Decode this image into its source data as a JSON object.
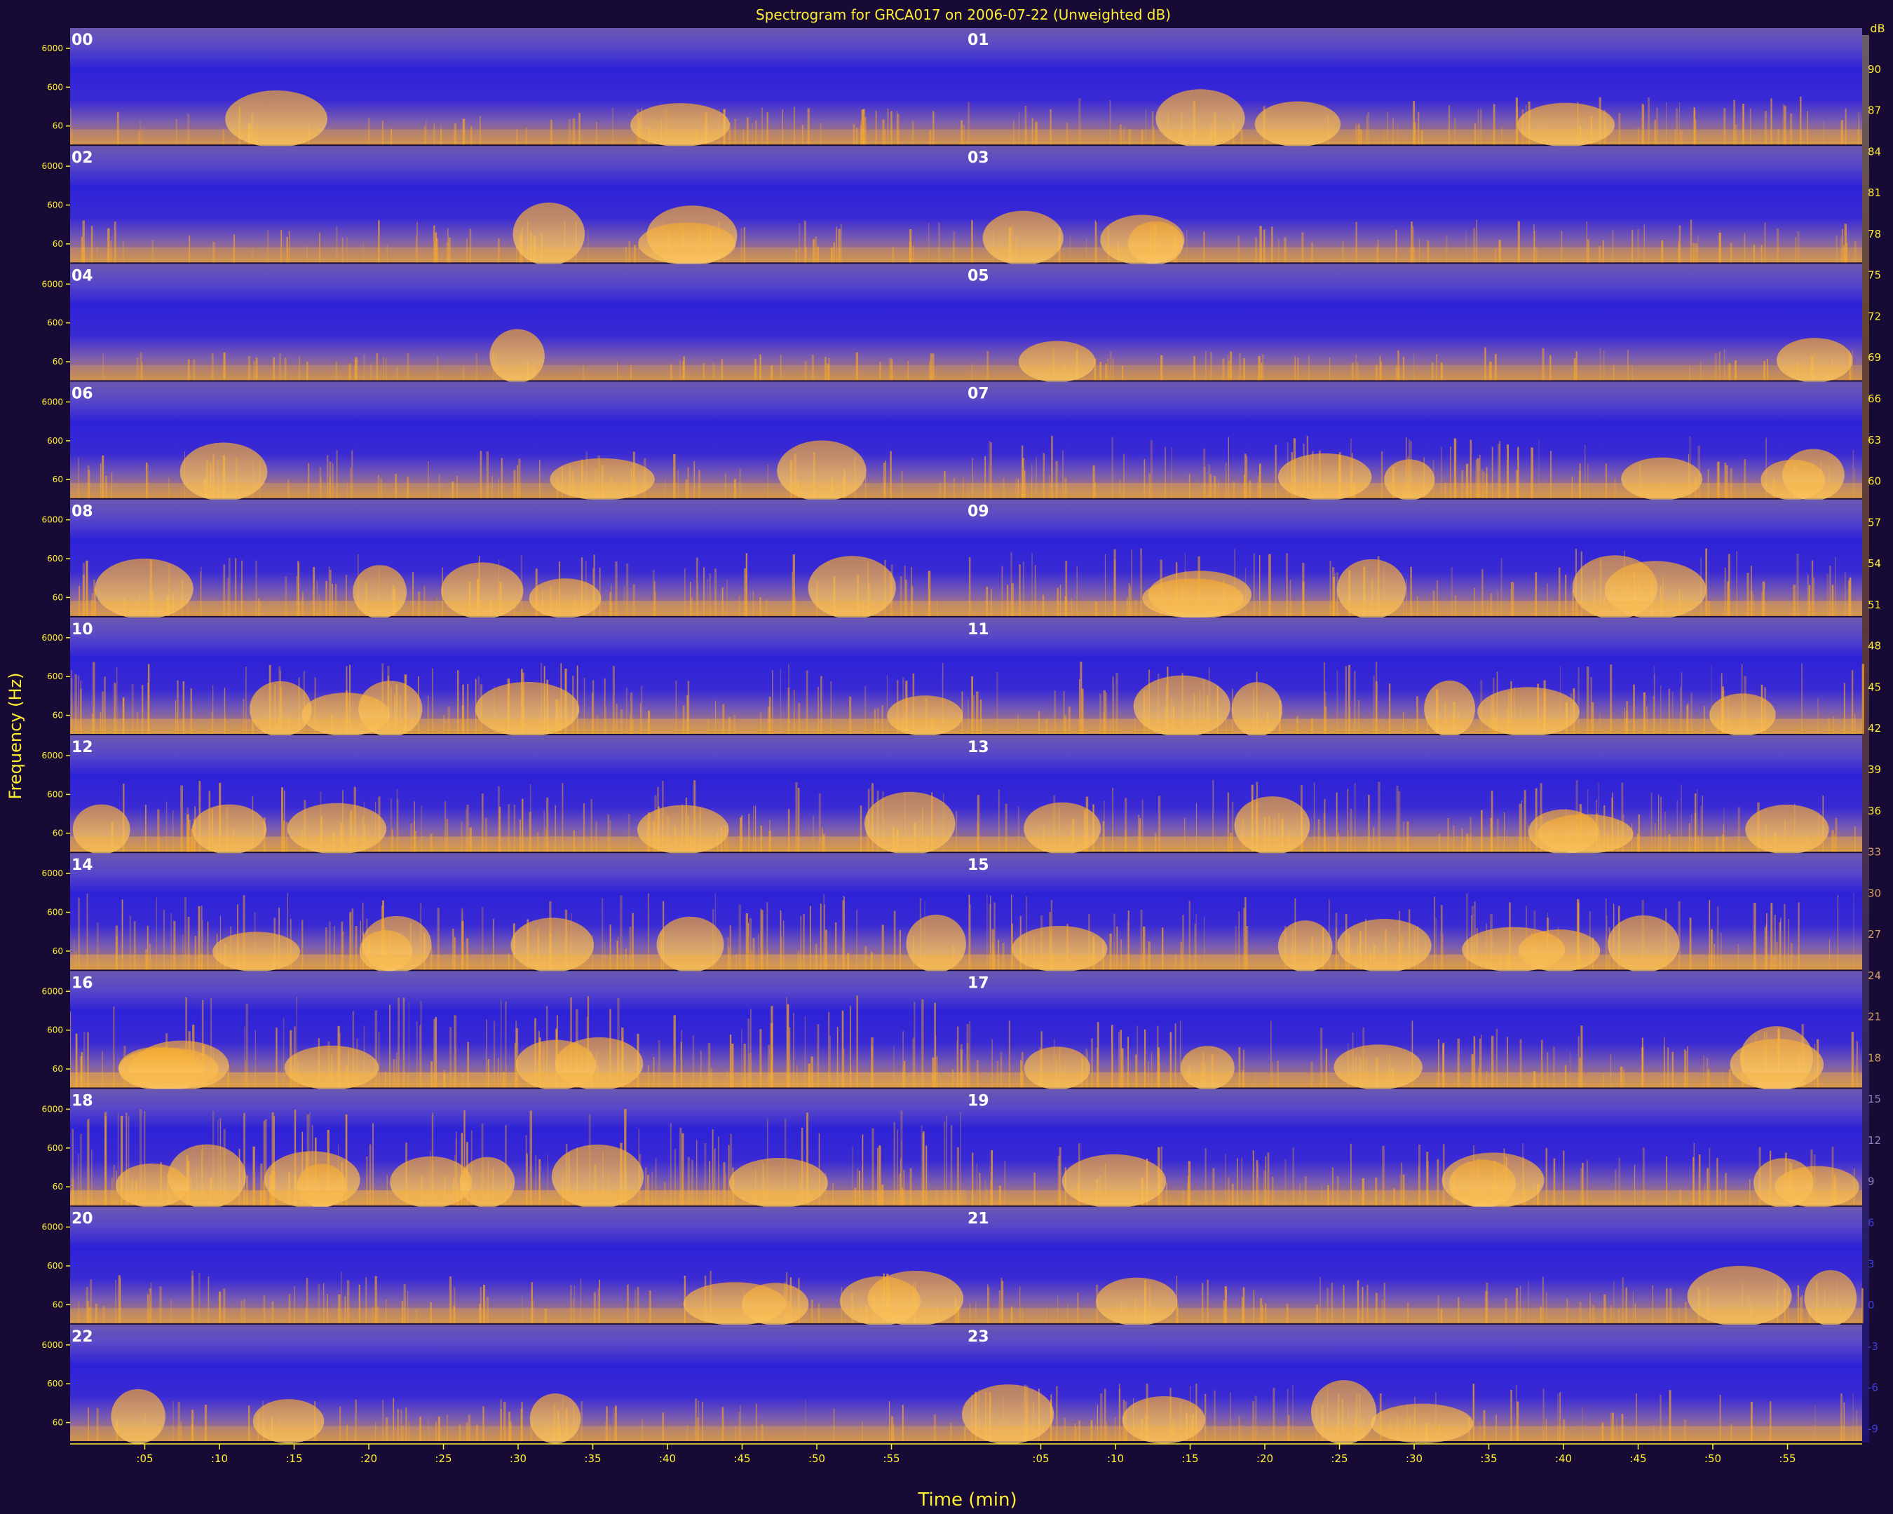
{
  "chart_data": {
    "type": "heatmap",
    "title": "Spectrogram for GRCA017 on 2006-07-22 (Unweighted dB)",
    "xlabel": "Time (min)",
    "ylabel": "Frequency (Hz)",
    "colorbar_unit": "dB",
    "hour_labels": [
      "00",
      "01",
      "02",
      "03",
      "04",
      "05",
      "06",
      "07",
      "08",
      "09",
      "10",
      "11",
      "12",
      "13",
      "14",
      "15",
      "16",
      "17",
      "18",
      "19",
      "20",
      "21",
      "22",
      "23"
    ],
    "freq_tick_labels": [
      "6000",
      "600",
      "60"
    ],
    "freq_tick_values": [
      6000,
      600,
      60
    ],
    "freq_range": [
      20,
      20000
    ],
    "freq_scale": "log",
    "time_tick_labels": [
      ":05",
      ":10",
      ":15",
      ":20",
      ":25",
      ":30",
      ":35",
      ":40",
      ":45",
      ":50",
      ":55"
    ],
    "time_tick_values": [
      5,
      10,
      15,
      20,
      25,
      30,
      35,
      40,
      45,
      50,
      55
    ],
    "time_range_per_half": [
      0,
      60
    ],
    "colorbar_ticks": [
      90,
      87,
      84,
      81,
      78,
      75,
      72,
      69,
      66,
      63,
      60,
      57,
      54,
      51,
      48,
      45,
      42,
      39,
      36,
      33,
      30,
      27,
      24,
      21,
      18,
      15,
      12,
      9,
      6,
      3,
      0,
      -3,
      -6,
      -9
    ],
    "colorbar_range": [
      -10,
      93
    ],
    "grid": false,
    "colors": {
      "background": "#170a35",
      "low": "#2a1fd8",
      "mid": "#6a55b8",
      "high": "#f0a020",
      "peak": "#fff0c0",
      "label": "#ffee33",
      "hour_label": "#ffffff"
    },
    "activity_per_hour": [
      0.25,
      0.35,
      0.3,
      0.3,
      0.15,
      0.2,
      0.35,
      0.5,
      0.5,
      0.55,
      0.6,
      0.6,
      0.6,
      0.6,
      0.65,
      0.65,
      0.8,
      0.55,
      0.85,
      0.5,
      0.4,
      0.35,
      0.3,
      0.45
    ]
  }
}
